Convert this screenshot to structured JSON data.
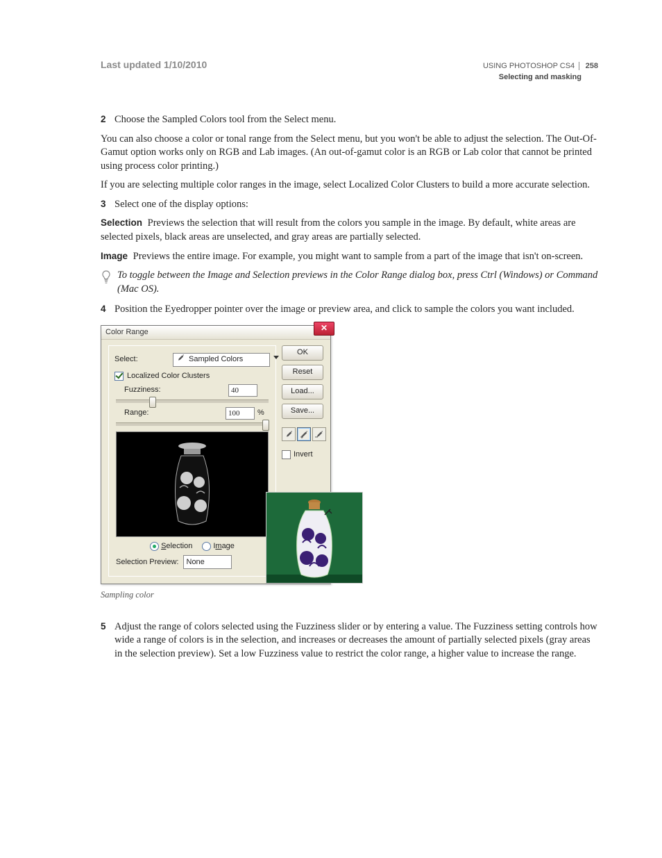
{
  "header": {
    "updated": "Last updated 1/10/2010",
    "title": "USING PHOTOSHOP CS4",
    "section": "Selecting and masking",
    "page": "258"
  },
  "steps": {
    "s2": {
      "num": "2",
      "text": "Choose the Sampled Colors tool from the Select menu."
    },
    "s3": {
      "num": "3",
      "text": "Select one of the display options:"
    },
    "s4": {
      "num": "4",
      "text": "Position the Eyedropper pointer over the image or preview area, and click to sample the colors you want included."
    },
    "s5": {
      "num": "5",
      "text": "Adjust the range of colors selected using the Fuzziness slider or by entering a value. The Fuzziness setting controls how wide a range of colors is in the selection, and increases or decreases the amount of partially selected pixels (gray areas in the selection preview). Set a low Fuzziness value to restrict the color range, a higher value to increase the range."
    }
  },
  "paras": {
    "p1": "You can also choose a color or tonal range from the Select menu, but you won't be able to adjust the selection. The Out-Of-Gamut option works only on RGB and Lab images. (An out-of-gamut color is an RGB or Lab color that cannot be printed using process color printing.)",
    "p2": "If you are selecting multiple color ranges in the image, select Localized Color Clusters to build a more accurate selection.",
    "sel_term": "Selection",
    "sel_text": "  Previews the selection that will result from the colors you sample in the image. By default, white areas are selected pixels, black areas are unselected, and gray areas are partially selected.",
    "img_term": "Image",
    "img_text": "  Previews the entire image. For example, you might want to sample from a part of the image that isn't on-screen.",
    "tip": "To toggle between the Image and Selection previews in the Color Range dialog box, press Ctrl (Windows) or Command (Mac OS)."
  },
  "figure": {
    "caption": "Sampling color"
  },
  "dialog": {
    "title": "Color Range",
    "select_label": "Select:",
    "select_value": "Sampled Colors",
    "localized_label": "Localized Color Clusters",
    "fuzziness_label": "Fuzziness:",
    "fuzziness_value": "40",
    "range_label": "Range:",
    "range_value": "100",
    "range_unit": "%",
    "radio_selection": "Selection",
    "radio_image": "Image",
    "selprev_label": "Selection Preview:",
    "selprev_value": "None",
    "btn_ok": "OK",
    "btn_reset": "Reset",
    "btn_load": "Load...",
    "btn_save": "Save...",
    "invert_label": "Invert"
  }
}
